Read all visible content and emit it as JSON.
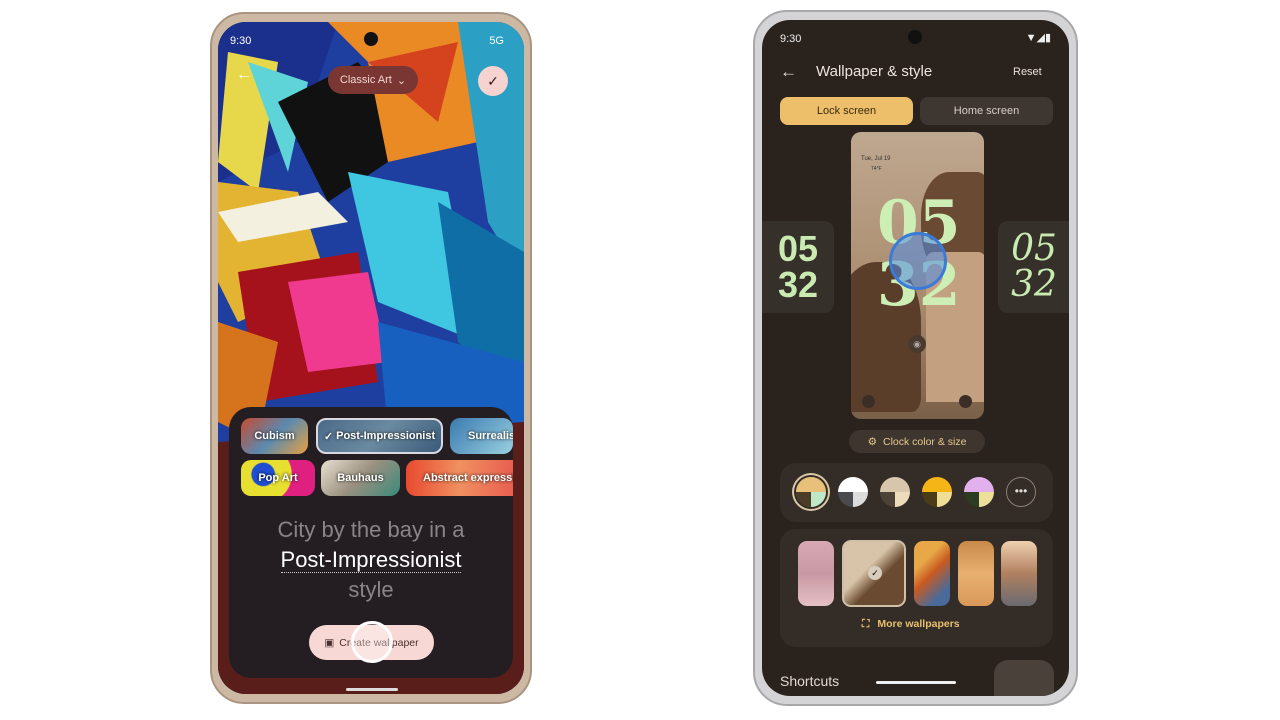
{
  "left_phone": {
    "status": {
      "time": "9:30",
      "network": "5G"
    },
    "category_dropdown": "Classic Art",
    "styles": [
      {
        "label": "Cubism"
      },
      {
        "label": "Post-Impressionist",
        "selected": true
      },
      {
        "label": "Surrealist"
      },
      {
        "label": "Pop Art"
      },
      {
        "label": "Bauhaus"
      },
      {
        "label": "Abstract expressionism"
      }
    ],
    "prompt": {
      "line1": "City by the bay in a",
      "line2": "Post-Impressionist",
      "line3": "style"
    },
    "create_button": "Create wallpaper"
  },
  "right_phone": {
    "status": {
      "time": "9:30"
    },
    "title": "Wallpaper & style",
    "reset": "Reset",
    "tabs": [
      {
        "label": "Lock screen",
        "active": true
      },
      {
        "label": "Home screen",
        "active": false
      }
    ],
    "preview": {
      "date": "Tue, Jul 19",
      "weather": "74°F",
      "clock_top": "05",
      "clock_bottom": "32"
    },
    "side_clocks": [
      {
        "top": "05",
        "bottom": "32"
      },
      {
        "top": "05",
        "bottom": "32"
      }
    ],
    "clock_button": "Clock color & size",
    "color_swatches": [
      [
        "#e8c079",
        "#4a3c26",
        "#bfe8c6"
      ],
      [
        "#ffffff",
        "#4a4a4e",
        "#dcdcdc"
      ],
      [
        "#d7c6ac",
        "#4c4238",
        "#ecdcbc"
      ],
      [
        "#f6b517",
        "#4a3c14",
        "#efdf96"
      ],
      [
        "#e2b0ec",
        "#2c3c22",
        "#ece09a"
      ]
    ],
    "more_wallpapers": "More wallpapers",
    "shortcuts": "Shortcuts",
    "accent": "#f0c06a"
  }
}
